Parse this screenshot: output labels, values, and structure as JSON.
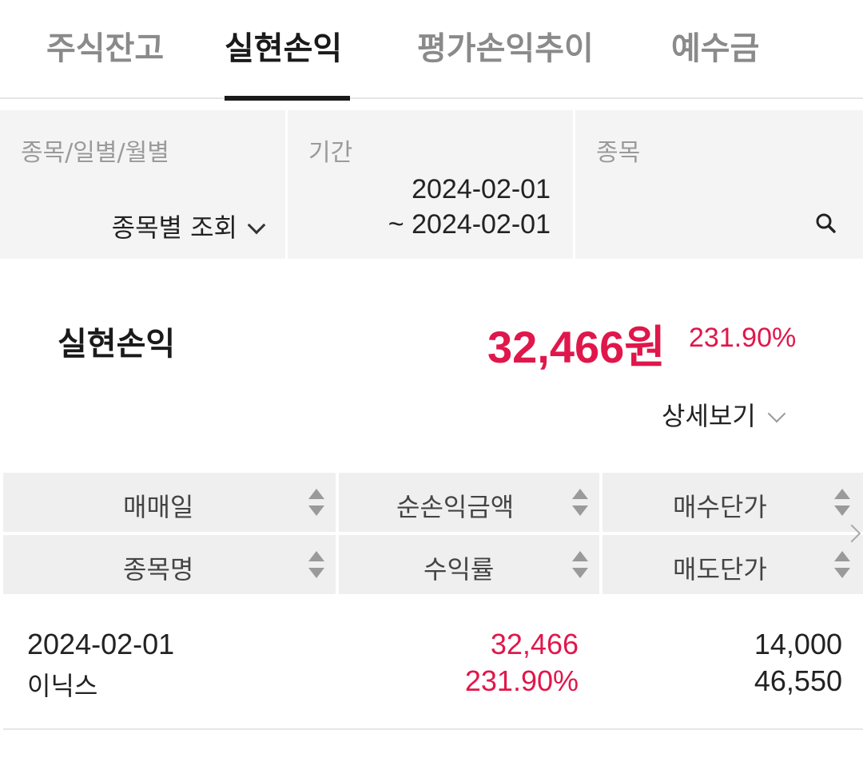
{
  "tabs": [
    {
      "label": "주식잔고"
    },
    {
      "label": "실현손익"
    },
    {
      "label": "평가손익추이"
    },
    {
      "label": "예수금"
    }
  ],
  "filters": {
    "type": {
      "label": "종목/일별/월별",
      "value": "종목별 조회"
    },
    "period": {
      "label": "기간",
      "start": "2024-02-01",
      "end": "~ 2024-02-01"
    },
    "stock": {
      "label": "종목"
    }
  },
  "summary": {
    "label": "실현손익",
    "amount": "32,466원",
    "rate": "231.90%",
    "detail_label": "상세보기"
  },
  "table": {
    "headers_row1": [
      "매매일",
      "순손익금액",
      "매수단가"
    ],
    "headers_row2": [
      "종목명",
      "수익률",
      "매도단가"
    ],
    "rows": [
      {
        "date": "2024-02-01",
        "name": "이닉스",
        "pnl": "32,466",
        "rate": "231.90%",
        "buy_price": "14,000",
        "sell_price": "46,550"
      }
    ]
  },
  "colors": {
    "accent": "#e0174b",
    "text": "#222222",
    "muted": "#9a9a9a",
    "panel": "#f4f4f4"
  },
  "icons": {
    "search": "search-icon",
    "dropdown": "chevron-down-icon",
    "sort": "sort-icon",
    "scroll": "chevron-right-icon"
  }
}
